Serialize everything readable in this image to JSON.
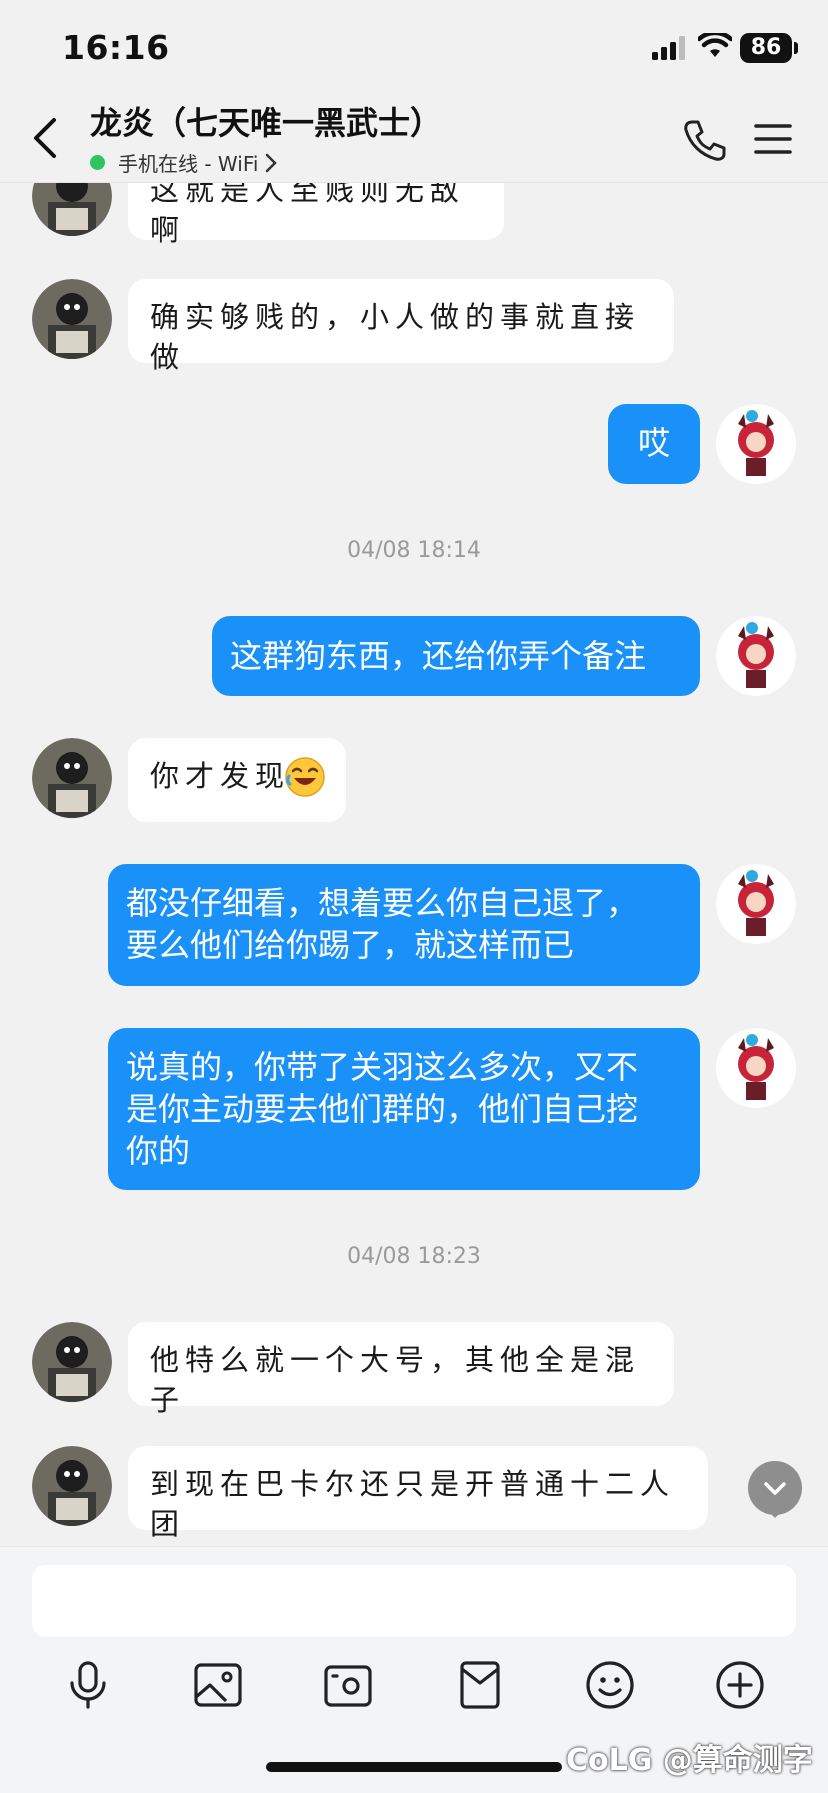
{
  "status_bar": {
    "time": "16:16",
    "battery": "86"
  },
  "header": {
    "title": "龙炎（七天唯一黑武士）",
    "online_status": "手机在线 - WiFi",
    "icons": [
      "back-icon",
      "phone-icon",
      "menu-icon",
      "chevron-right-icon"
    ]
  },
  "messages": [
    {
      "side": "in",
      "text": "这就是人至贱则无敌啊"
    },
    {
      "side": "in",
      "text": "确实够贱的，小人做的事就直接做"
    },
    {
      "side": "out",
      "text": "哎"
    },
    {
      "side": "timestamp",
      "text": "04/08 18:14"
    },
    {
      "side": "out",
      "text": "这群狗东西，还给你弄个备注"
    },
    {
      "side": "in",
      "text": "你才发现",
      "emoji": "laughing-tears-emoji"
    },
    {
      "side": "out",
      "line1": "都没仔细看，想着要么你自己退了，",
      "line2": "要么他们给你踢了，就这样而已"
    },
    {
      "side": "out",
      "line1": "说真的，你带了关羽这么多次，又不",
      "line2": "是你主动要去他们群的，他们自己挖",
      "line3": "你的"
    },
    {
      "side": "timestamp",
      "text": "04/08 18:23"
    },
    {
      "side": "in",
      "text": "他特么就一个大号，其他全是混子"
    },
    {
      "side": "in",
      "text": "到现在巴卡尔还只是开普通十二人团"
    }
  ],
  "toolbar": {
    "icons": [
      "microphone-icon",
      "image-icon",
      "camera-icon",
      "red-packet-icon",
      "emoji-icon",
      "plus-icon"
    ]
  },
  "watermark": "CoLG @算命测字",
  "colors": {
    "outgoing_bubble": "#1a91f9",
    "incoming_bubble": "#ffffff",
    "background": "#f1f1f1"
  }
}
